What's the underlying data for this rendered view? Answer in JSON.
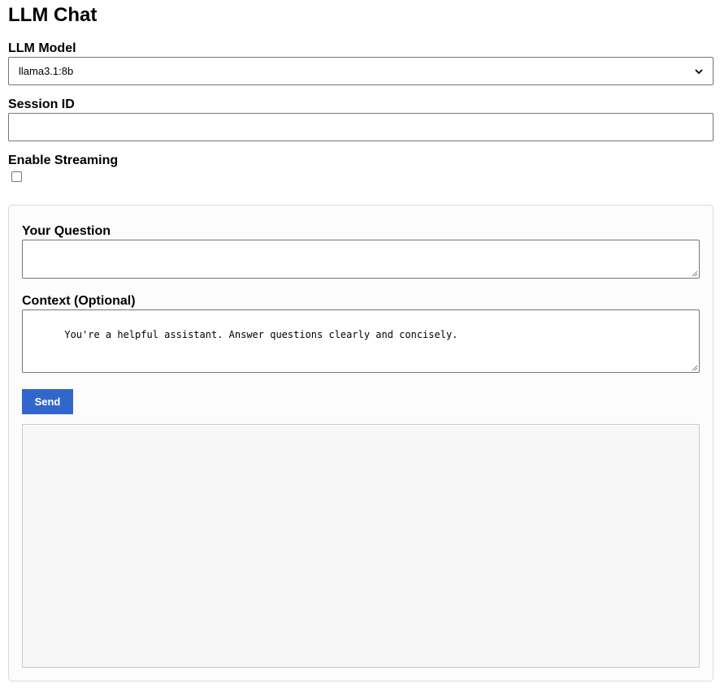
{
  "title": "LLM Chat",
  "model": {
    "label": "LLM Model",
    "selected": "llama3.1:8b"
  },
  "session": {
    "label": "Session ID",
    "value": ""
  },
  "streaming": {
    "label": "Enable Streaming",
    "checked": false
  },
  "question": {
    "label": "Your Question",
    "value": ""
  },
  "context": {
    "label": "Context (Optional)",
    "value": "You're a helpful assistant. Answer questions clearly and concisely."
  },
  "send_label": "Send",
  "response_text": "",
  "colors": {
    "accent": "#3366cc",
    "panel_bg": "#fcfcfc",
    "response_bg": "#f7f7f7"
  }
}
